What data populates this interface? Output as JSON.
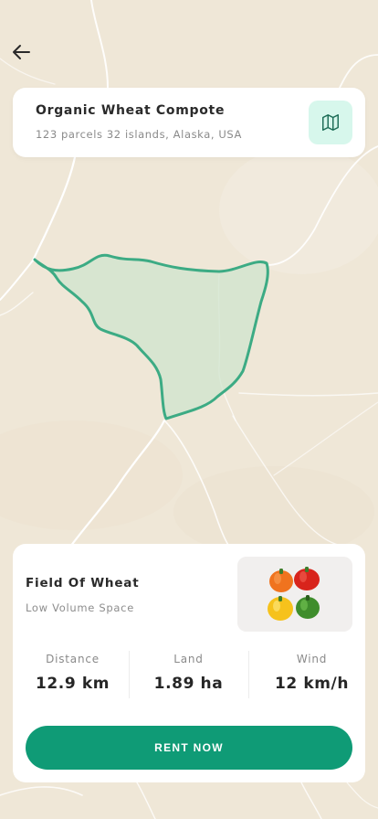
{
  "colors": {
    "accent": "#0f9b76",
    "accent_light": "#d7f7ec",
    "map_background": "#efe7d7",
    "plot_stroke": "#3cab84",
    "plot_fill": "#cfe4cd"
  },
  "icons": {
    "back": "arrow-left-icon",
    "map": "folded-map-icon"
  },
  "location": {
    "title": "Organic Wheat Compote",
    "subtitle": "123 parcels 32 islands, Alaska, USA"
  },
  "field": {
    "title": "Field Of Wheat",
    "subtitle": "Low Volume Space",
    "image": "bell-peppers-photo"
  },
  "stats": [
    {
      "label": "Distance",
      "value": "12.9 km"
    },
    {
      "label": "Land",
      "value": "1.89 ha"
    },
    {
      "label": "Wind",
      "value": "12 km/h"
    }
  ],
  "actions": {
    "rent_label": "RENT NOW"
  }
}
